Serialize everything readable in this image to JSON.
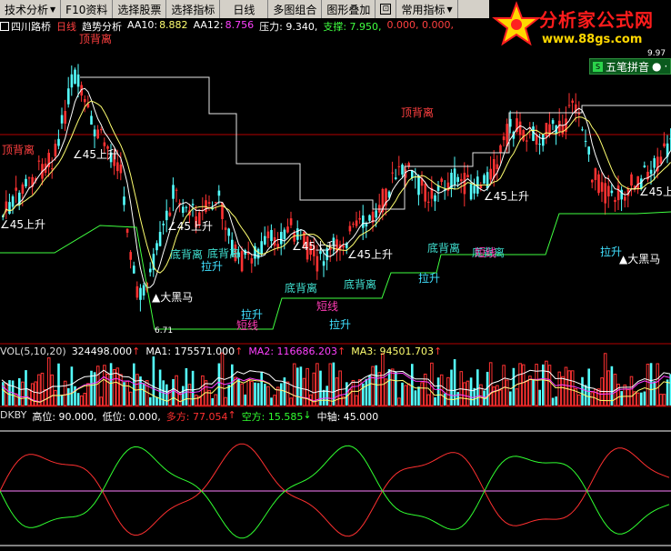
{
  "toolbar": {
    "items": [
      {
        "label": "技术分析",
        "caret": "▼"
      },
      {
        "label": "F10资料",
        "caret": ""
      },
      {
        "label": "选择股票",
        "caret": ""
      },
      {
        "label": "选择指标",
        "caret": ""
      },
      {
        "label": "日线",
        "caret": ""
      },
      {
        "label": "多图组合",
        "caret": ""
      },
      {
        "label": "图形叠加",
        "caret": ""
      },
      {
        "label": "常用指标",
        "caret": "▼"
      }
    ],
    "icon_glyph": "⊡"
  },
  "watermark": {
    "title": "分析家公式网",
    "url": "www.88gs.com"
  },
  "stock_bar": {
    "name": "四川路桥",
    "period": "日线",
    "indicator": "趋势分析",
    "aa10_label": "AA10:",
    "aa10_value": "8.882",
    "aa12_label": "AA12:",
    "aa12_value": "8.756",
    "pressure": "压力: 9.340,",
    "support": "支撑: 7.950,",
    "extra": "0.000, 0.000,"
  },
  "ime": {
    "label": "五笔拼音",
    "icon": "S",
    "dot": "●",
    "more": "·"
  },
  "price_pane": {
    "labels": [
      {
        "text": "顶背离",
        "color": "#ff4040"
      },
      {
        "text": "顶背离",
        "color": "#ff4040"
      },
      {
        "text": "顶背离",
        "color": "#ff4040"
      },
      {
        "text": "∠45上升",
        "color": "#ffffff"
      },
      {
        "text": "∠45上升",
        "color": "#ffffff"
      },
      {
        "text": "∠45上升",
        "color": "#ffffff"
      },
      {
        "text": "∠45上升",
        "color": "#ffffff"
      },
      {
        "text": "∠45上升",
        "color": "#ffffff"
      },
      {
        "text": "∠45上升",
        "color": "#ffffff"
      },
      {
        "text": "∠45上升",
        "color": "#ffffff"
      },
      {
        "text": "底背离",
        "color": "#40e0d0"
      },
      {
        "text": "底背离",
        "color": "#40e0d0"
      },
      {
        "text": "底背离",
        "color": "#40e0d0"
      },
      {
        "text": "底背离",
        "color": "#40e0d0"
      },
      {
        "text": "底背离",
        "color": "#40e0d0"
      },
      {
        "text": "底背离",
        "color": "#40e0d0"
      },
      {
        "text": "拉升",
        "color": "#40e0ff"
      },
      {
        "text": "拉升",
        "color": "#40e0ff"
      },
      {
        "text": "拉升",
        "color": "#40e0ff"
      },
      {
        "text": "拉升",
        "color": "#40e0ff"
      },
      {
        "text": "拉升",
        "color": "#40e0ff"
      },
      {
        "text": "短线",
        "color": "#ff3cb4"
      },
      {
        "text": "短线",
        "color": "#ff3cb4"
      },
      {
        "text": "短线",
        "color": "#ff3cb4"
      },
      {
        "text": "▲大黑马",
        "color": "#ffffff"
      },
      {
        "text": "▲大黑马",
        "color": "#ffffff"
      },
      {
        "text": "6.71",
        "color": "#ffffff"
      },
      {
        "text": "9.97",
        "color": "#ffffff"
      }
    ]
  },
  "vol_pane": {
    "name": "VOL(5,10,20)",
    "value": "324498.000",
    "ma1": "MA1: 175571.000",
    "ma2": "MA2: 116686.203",
    "ma3": "MA3: 94501.703",
    "arrow": "↑"
  },
  "kdj_pane": {
    "name": "DKBY",
    "high": "高位: 90.000,",
    "low": "低位: 0.000,",
    "bull": "多方: 77.054",
    "bear": "空方: 15.585",
    "mid": "中轴: 45.000",
    "arrow_up": "↑",
    "arrow_down": "↓"
  },
  "colors": {
    "up": "#ff3232",
    "down": "#54ffff",
    "ma_white": "#ffffff",
    "ma_yellow": "#ffff70",
    "ma_green": "#40ff40",
    "ma_magenta": "#ff40ff",
    "step": "#e6e6e6",
    "support": "#40ff40",
    "hline": "#b40000",
    "bull": "#ff3030",
    "bear": "#30ff30"
  }
}
